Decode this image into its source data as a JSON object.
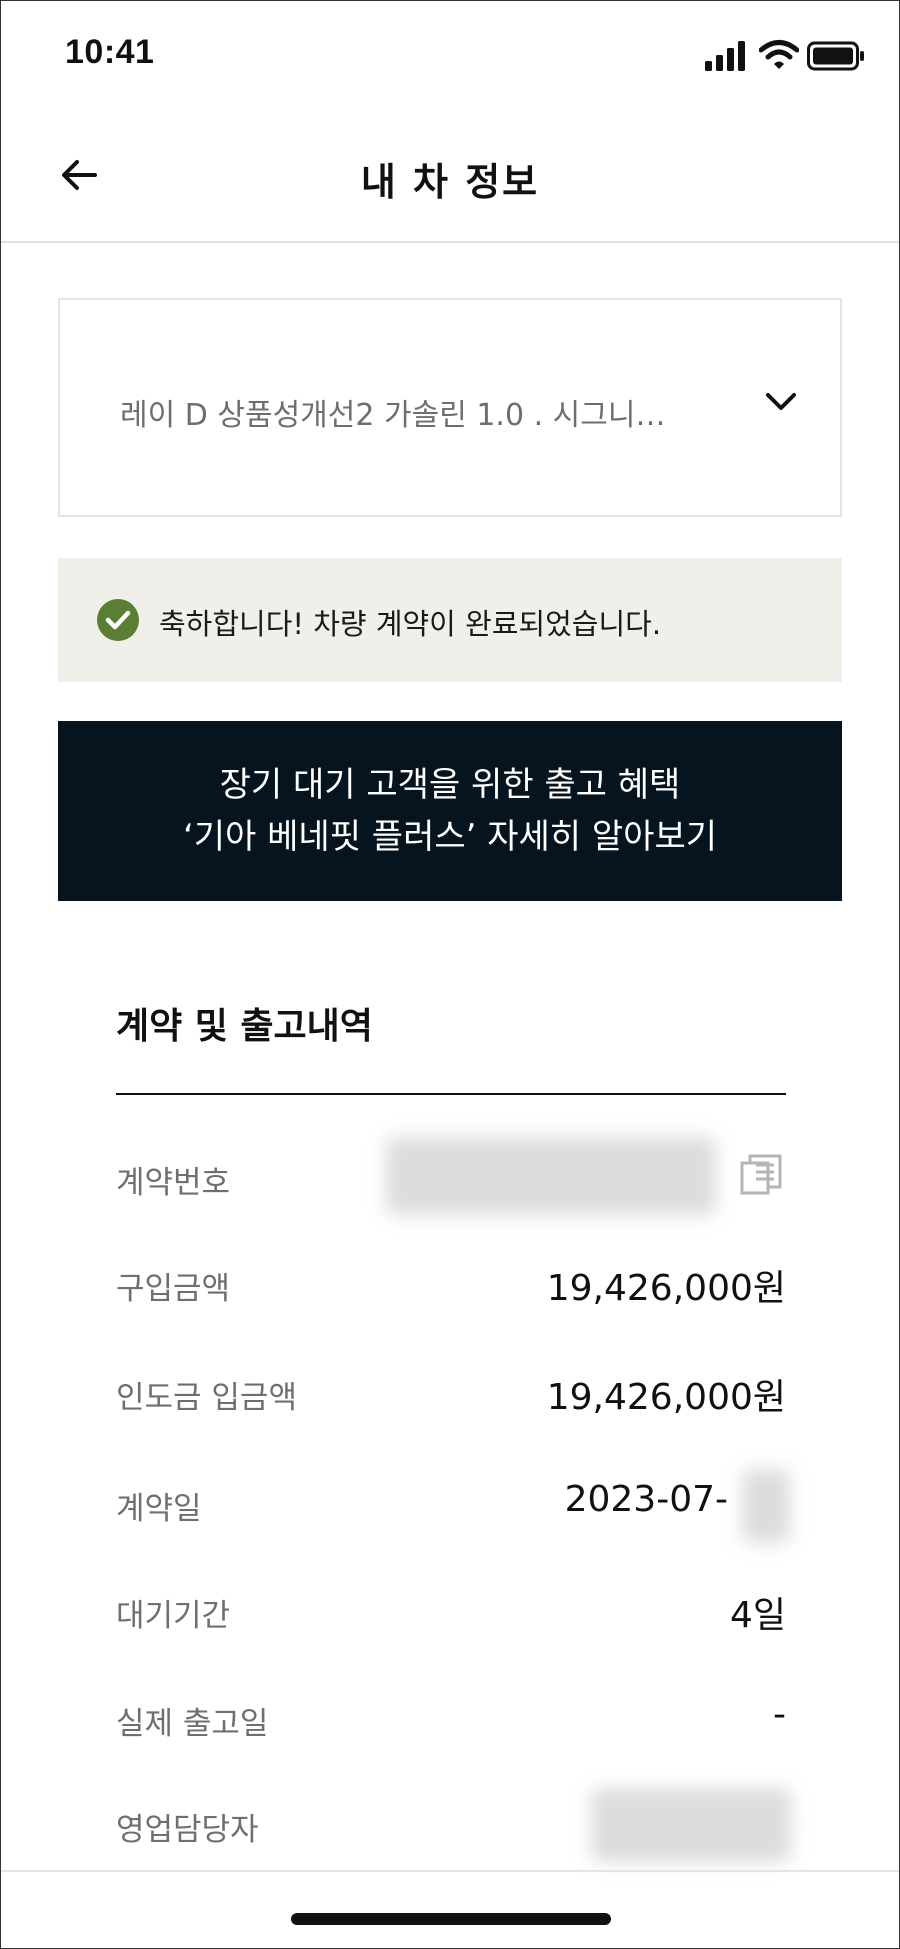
{
  "status_bar": {
    "time": "10:41"
  },
  "header": {
    "title": "내 차 정보"
  },
  "vehicle_selector": {
    "selected": "레이 D 상품성개선2 가솔린 1.0 . 시그니…"
  },
  "notice": {
    "text": "축하합니다! 차량 계약이 완료되었습니다."
  },
  "banner": {
    "line1": "장기 대기 고객을 위한 출고 혜택",
    "line2": "‘기아 베네핏 플러스’ 자세히 알아보기"
  },
  "contract": {
    "title": "계약 및 출고내역",
    "rows": [
      {
        "label": "계약번호",
        "value": ""
      },
      {
        "label": "구입금액",
        "value": "19,426,000원"
      },
      {
        "label": "인도금 입금액",
        "value": "19,426,000원"
      },
      {
        "label": "계약일",
        "value": "2023-07-"
      },
      {
        "label": "대기기간",
        "value": "4일"
      },
      {
        "label": "실제 출고일",
        "value": "-"
      },
      {
        "label": "영업담당자",
        "value": ""
      }
    ]
  },
  "colors": {
    "banner_bg": "#05141f",
    "notice_bg": "#f0f0ea",
    "check_green": "#5a7f33",
    "label_gray": "#6f6f6f"
  },
  "icons": [
    "back-arrow-icon",
    "chevron-down-icon",
    "check-circle-icon",
    "copy-icon",
    "signal-icon",
    "wifi-icon",
    "battery-icon"
  ]
}
